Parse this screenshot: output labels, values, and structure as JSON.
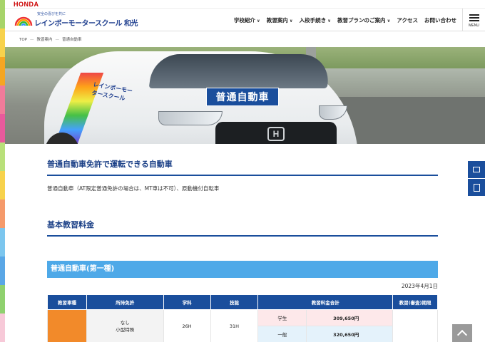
{
  "honda": "HONDA",
  "logo": {
    "tagline": "安全の喜びを共に",
    "name": "レインボーモータースクール 和光"
  },
  "nav": [
    {
      "label": "学校紹介"
    },
    {
      "label": "教習案内"
    },
    {
      "label": "入校手続き"
    },
    {
      "label": "教習プランのご案内"
    },
    {
      "label": "アクセス"
    },
    {
      "label": "お問い合わせ"
    }
  ],
  "menu_label": "MENU",
  "breadcrumb": [
    "TOP",
    "教習案内",
    "普通自動車"
  ],
  "hero": {
    "title": "普通自動車",
    "car_text": "レインボーモータースクール"
  },
  "section1": {
    "heading": "普通自動車免許で運転できる自動車",
    "description": "普通自動車（AT限定普通免許の場合は、MT車は不可）、原動機付自転車"
  },
  "section2": {
    "heading": "基本教習料金"
  },
  "fee": {
    "category_title": "普通自動車(第一種)",
    "date": "2023年4月1日",
    "headers": [
      "教習車種",
      "所持免許",
      "学科",
      "技能",
      "教習料金合計",
      "教習(審査)期限"
    ],
    "rows": [
      {
        "license": "なし",
        "license2": "小型特殊",
        "academic": "26H",
        "skill": "31H",
        "type": "学生",
        "price": "309,650円"
      },
      {
        "type": "一般",
        "price": "320,650円"
      }
    ]
  },
  "colors": {
    "brand_blue": "#1a4e9c",
    "bar_blue": "#4ea9e8",
    "swatch_orange": "#f28a2a"
  }
}
